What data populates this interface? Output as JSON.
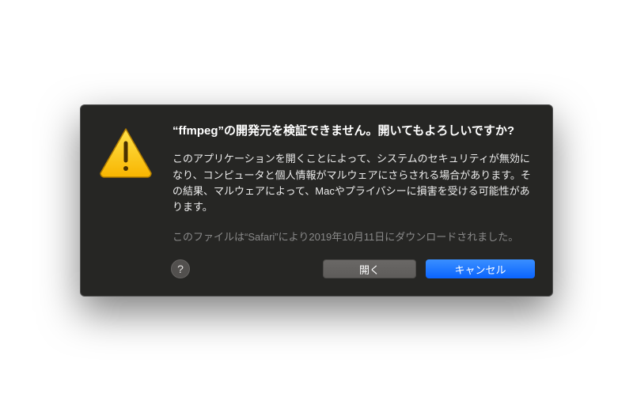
{
  "dialog": {
    "title": "“ffmpeg”の開発元を検証できません。開いてもよろしいですか?",
    "body": "このアプリケーションを開くことによって、システムのセキュリティが無効になり、コンピュータと個人情報がマルウェアにさらされる場合があります。その結果、マルウェアによって、Macやプライバシーに損害を受ける可能性があります。",
    "download_note": "このファイルは“Safari”により2019年10月11日にダウンロードされました。",
    "buttons": {
      "help": "?",
      "open": "開く",
      "cancel": "キャンセル"
    },
    "icon": "warning-triangle"
  }
}
